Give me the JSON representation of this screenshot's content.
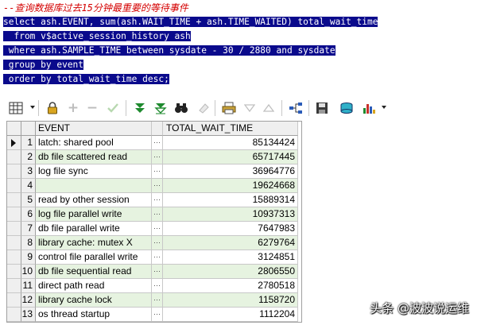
{
  "editor": {
    "comment": "--查询数据库过去15分钟最重要的等待事件",
    "lines": [
      "select ash.EVENT, sum(ash.WAIT_TIME + ash.TIME_WAITED) total_wait_time",
      "  from v$active_session_history ash",
      " where ash.SAMPLE_TIME between sysdate - 30 / 2880 and sysdate",
      " group by event",
      " order by total_wait_time desc;"
    ]
  },
  "toolbar": {
    "icons": [
      "grid-icon",
      "lock-icon",
      "plus-icon",
      "minus-icon",
      "check-icon",
      "filter-down-icon",
      "filter-clear-icon",
      "binoculars-icon",
      "eraser-icon",
      "print-icon",
      "triangle-down-icon",
      "triangle-up-icon",
      "link-icon",
      "save-icon",
      "database-icon",
      "chart-icon"
    ]
  },
  "grid": {
    "columns": [
      "EVENT",
      "TOTAL_WAIT_TIME"
    ],
    "dots": "···",
    "rows": [
      {
        "num": "1",
        "event": "latch: shared pool",
        "value": "85134424"
      },
      {
        "num": "2",
        "event": "db file scattered read",
        "value": "65717445"
      },
      {
        "num": "3",
        "event": "log file sync",
        "value": "36964776"
      },
      {
        "num": "4",
        "event": "",
        "value": "19624668"
      },
      {
        "num": "5",
        "event": "read by other session",
        "value": "15889314"
      },
      {
        "num": "6",
        "event": "log file parallel write",
        "value": "10937313"
      },
      {
        "num": "7",
        "event": "db file parallel write",
        "value": "7647983"
      },
      {
        "num": "8",
        "event": "library cache: mutex X",
        "value": "6279764"
      },
      {
        "num": "9",
        "event": "control file parallel write",
        "value": "3124851"
      },
      {
        "num": "10",
        "event": "db file sequential read",
        "value": "2806550"
      },
      {
        "num": "11",
        "event": "direct path read",
        "value": "2780518"
      },
      {
        "num": "12",
        "event": "library cache lock",
        "value": "1158720"
      },
      {
        "num": "13",
        "event": "os thread startup",
        "value": "1112204"
      }
    ]
  },
  "watermark": "头条 @波波说运维",
  "colors": {
    "highlight": "#0a0a8c",
    "comment": "#d40000",
    "even_row": "#e6f3e0"
  }
}
